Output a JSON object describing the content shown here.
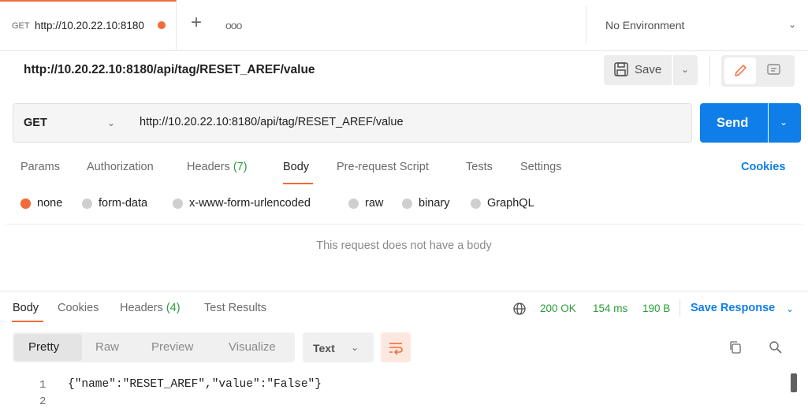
{
  "tab": {
    "method": "GET",
    "url": "http://10.20.22.10:8180",
    "plus": "+",
    "more": "ooo"
  },
  "environment": {
    "label": "No Environment"
  },
  "request": {
    "title": "http://10.20.22.10:8180/api/tag/RESET_AREF/value",
    "save_label": "Save",
    "method": "GET",
    "url": "http://10.20.22.10:8180/api/tag/RESET_AREF/value",
    "send_label": "Send"
  },
  "request_tabs": {
    "params": "Params",
    "authorization": "Authorization",
    "headers": "Headers",
    "headers_count": "(7)",
    "body": "Body",
    "prerequest": "Pre-request Script",
    "tests": "Tests",
    "settings": "Settings",
    "cookies": "Cookies"
  },
  "body_types": {
    "none": "none",
    "form_data": "form-data",
    "urlencoded": "x-www-form-urlencoded",
    "raw": "raw",
    "binary": "binary",
    "graphql": "GraphQL"
  },
  "no_body_text": "This request does not have a body",
  "response_tabs": {
    "body": "Body",
    "cookies": "Cookies",
    "headers": "Headers",
    "headers_count": "(4)",
    "test_results": "Test Results"
  },
  "status": {
    "code": "200 OK",
    "time": "154 ms",
    "size": "190 B"
  },
  "save_response": "Save Response",
  "view_tabs": {
    "pretty": "Pretty",
    "raw": "Raw",
    "preview": "Preview",
    "visualize": "Visualize"
  },
  "format": "Text",
  "code_lines": [
    {
      "num": "1",
      "text": "{\"name\":\"RESET_AREF\",\"value\":\"False\"}"
    },
    {
      "num": "2",
      "text": ""
    }
  ],
  "colors": {
    "accent": "#f26b3a",
    "primary": "#0f7ee8",
    "success": "#2a9d3a"
  },
  "icons": {
    "save": "floppy-icon",
    "edit": "pencil-icon",
    "comments": "comment-icon",
    "globe": "globe-icon",
    "wrap": "wrap-lines-icon",
    "copy": "copy-icon",
    "search": "search-icon"
  }
}
